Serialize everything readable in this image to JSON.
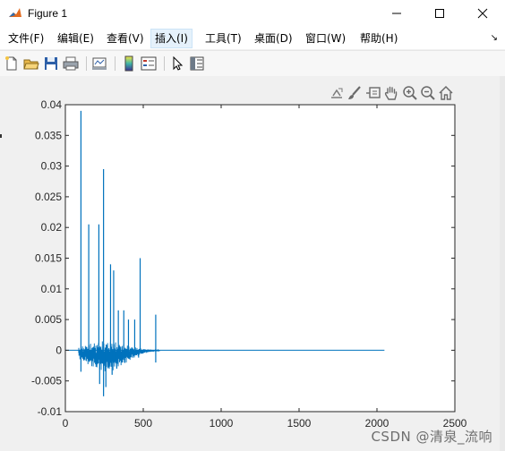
{
  "window": {
    "title": "Figure 1"
  },
  "menu": {
    "items": [
      {
        "label": "文件(F)"
      },
      {
        "label": "编辑(E)"
      },
      {
        "label": "查看(V)"
      },
      {
        "label": "插入(I)"
      },
      {
        "label": "工具(T)"
      },
      {
        "label": "桌面(D)"
      },
      {
        "label": "窗口(W)"
      },
      {
        "label": "帮助(H)"
      }
    ],
    "active": "插入(I)"
  },
  "toolbar": {
    "buttons": [
      "new-figure-icon",
      "open-file-icon",
      "save-icon",
      "print-icon",
      "link-plot-icon",
      "insert-colorbar-icon",
      "insert-legend-icon",
      "edit-plot-arrow-icon",
      "property-inspector-icon"
    ]
  },
  "axes_toolbar": {
    "buttons": [
      "export-icon",
      "brush-icon",
      "data-tips-icon",
      "pan-hand-icon",
      "zoom-in-icon",
      "zoom-out-icon",
      "home-icon"
    ]
  },
  "colors": {
    "line": "#0072bd",
    "axes_bg": "#ffffff",
    "figure_bg": "#f0f0f0"
  },
  "watermark": "CSDN @清泉_流响",
  "chart_data": {
    "type": "line",
    "xlim": [
      0,
      2500
    ],
    "ylim": [
      -0.01,
      0.04
    ],
    "x_ticks": [
      "0",
      "500",
      "1000",
      "1500",
      "2000",
      "2500"
    ],
    "y_ticks": [
      "-0.01",
      "-0.005",
      "0",
      "0.005",
      "0.01",
      "0.015",
      "0.02",
      "0.025",
      "0.03",
      "0.035",
      "0.04"
    ],
    "grid": false,
    "series": [
      {
        "x_range": [
          1,
          2048
        ],
        "spikes": [
          {
            "x": 100,
            "y": 0.039
          },
          {
            "x": 150,
            "y": 0.0205
          },
          {
            "x": 215,
            "y": 0.0205
          },
          {
            "x": 245,
            "y": 0.0295
          },
          {
            "x": 290,
            "y": 0.014
          },
          {
            "x": 310,
            "y": 0.013
          },
          {
            "x": 340,
            "y": 0.0065
          },
          {
            "x": 375,
            "y": 0.0065
          },
          {
            "x": 405,
            "y": 0.005
          },
          {
            "x": 445,
            "y": 0.005
          },
          {
            "x": 480,
            "y": 0.015
          },
          {
            "x": 580,
            "y": 0.0058
          }
        ],
        "troughs": [
          {
            "x": 100,
            "y": -0.0035
          },
          {
            "x": 220,
            "y": -0.0055
          },
          {
            "x": 245,
            "y": -0.0075
          },
          {
            "x": 260,
            "y": -0.006
          },
          {
            "x": 300,
            "y": -0.004
          },
          {
            "x": 330,
            "y": -0.003
          },
          {
            "x": 380,
            "y": -0.002
          },
          {
            "x": 470,
            "y": -0.0012
          },
          {
            "x": 580,
            "y": -0.002
          }
        ],
        "baseline": 0
      }
    ]
  }
}
